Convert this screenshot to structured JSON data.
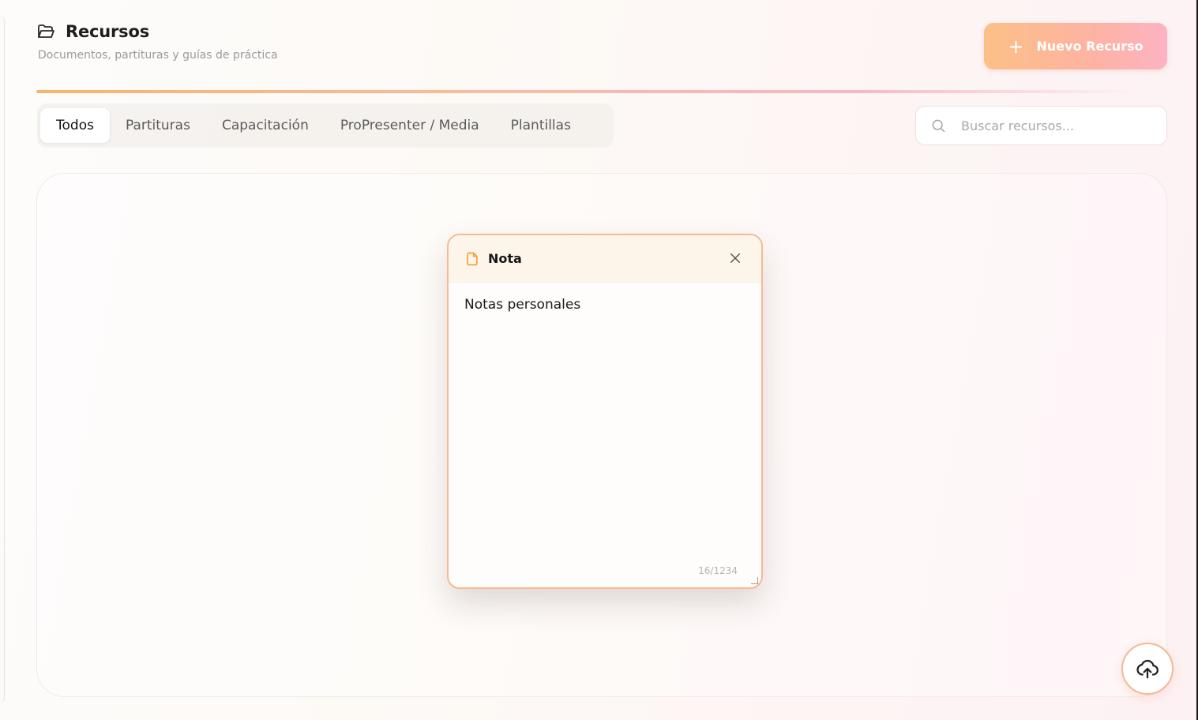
{
  "header": {
    "icon": "folder-open-icon",
    "title": "Recursos",
    "subtitle": "Documentos, partituras y guías de práctica"
  },
  "new_button": {
    "icon": "plus-icon",
    "label": "Nuevo Recurso"
  },
  "tabs": [
    {
      "label": "Todos",
      "active": true
    },
    {
      "label": "Partituras",
      "active": false
    },
    {
      "label": "Capacitación",
      "active": false
    },
    {
      "label": "ProPresenter / Media",
      "active": false
    },
    {
      "label": "Plantillas",
      "active": false
    }
  ],
  "search": {
    "icon": "search-icon",
    "placeholder": "Buscar recursos...",
    "value": ""
  },
  "note": {
    "icon": "file-icon",
    "title": "Nota",
    "close_icon": "close-icon",
    "body": "Notas personales",
    "counter": "16/1234"
  },
  "upload_button": {
    "icon": "cloud-upload-icon"
  },
  "colors": {
    "accent_orange": "#f6b56c",
    "accent_pink": "#fdb3c2",
    "note_border": "#f8b98e",
    "note_header_bg": "#fdf5ea"
  }
}
